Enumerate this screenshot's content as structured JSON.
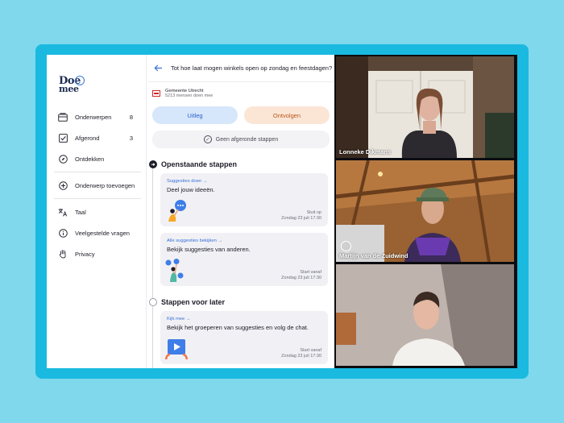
{
  "brand": {
    "logo_top": "Doe",
    "logo_bottom": "mee"
  },
  "sidebar": {
    "items": [
      {
        "label": "Onderwerpen",
        "count": "8",
        "icon": "inbox-icon"
      },
      {
        "label": "Afgerond",
        "count": "3",
        "icon": "checkbox-icon"
      },
      {
        "label": "Ontdekken",
        "count": "",
        "icon": "compass-icon"
      },
      {
        "label": "Onderwerp toevoegen",
        "count": "",
        "icon": "plus-circle-icon"
      },
      {
        "label": "Taal",
        "count": "",
        "icon": "translate-icon"
      },
      {
        "label": "Veelgestelde vragen",
        "count": "",
        "icon": "info-icon"
      },
      {
        "label": "Privacy",
        "count": "",
        "icon": "hand-icon"
      }
    ]
  },
  "topic": {
    "title": "Tot hoe laat mogen winkels open op zondag en feestdagen?",
    "org_name": "Gemeente Utrecht",
    "org_count": "5213 mensen doen mee"
  },
  "actions": {
    "uitleg": "Uitleg",
    "ontvolgen": "Ontvolgen"
  },
  "completed": {
    "label": "Geen afgeronde stappen"
  },
  "open_steps": {
    "heading": "Openstaande stappen",
    "cards": [
      {
        "link": "Suggesties doen →",
        "text": "Deel jouw ideeën.",
        "meta_1": "Sluit op",
        "meta_2": "Zondag 23 juli 17:30"
      },
      {
        "link": "Alle suggesties bekijken →",
        "text": "Bekijk suggesties van anderen.",
        "meta_1": "Start vanaf",
        "meta_2": "Zondag 23 juli 17:30"
      }
    ]
  },
  "later_steps": {
    "heading": "Stappen voor later",
    "cards": [
      {
        "link": "Kijk mee →",
        "text": "Bekijk het groeperen van suggesties en volg de chat.",
        "meta_1": "Start vanaf",
        "meta_2": "Zondag 23 juli 17:30"
      }
    ]
  },
  "video": {
    "participants": [
      {
        "name": "Lonneke Dikmans"
      },
      {
        "name": "Martijn van de Zuidwind"
      },
      {
        "name": ""
      }
    ]
  },
  "colors": {
    "page_bg": "#7fd8ec",
    "frame": "#1ab9e0",
    "accent_blue": "#3a6fd8",
    "uitleg_bg": "#d6e6fb",
    "ontvolgen_bg": "#fbe6d6"
  }
}
